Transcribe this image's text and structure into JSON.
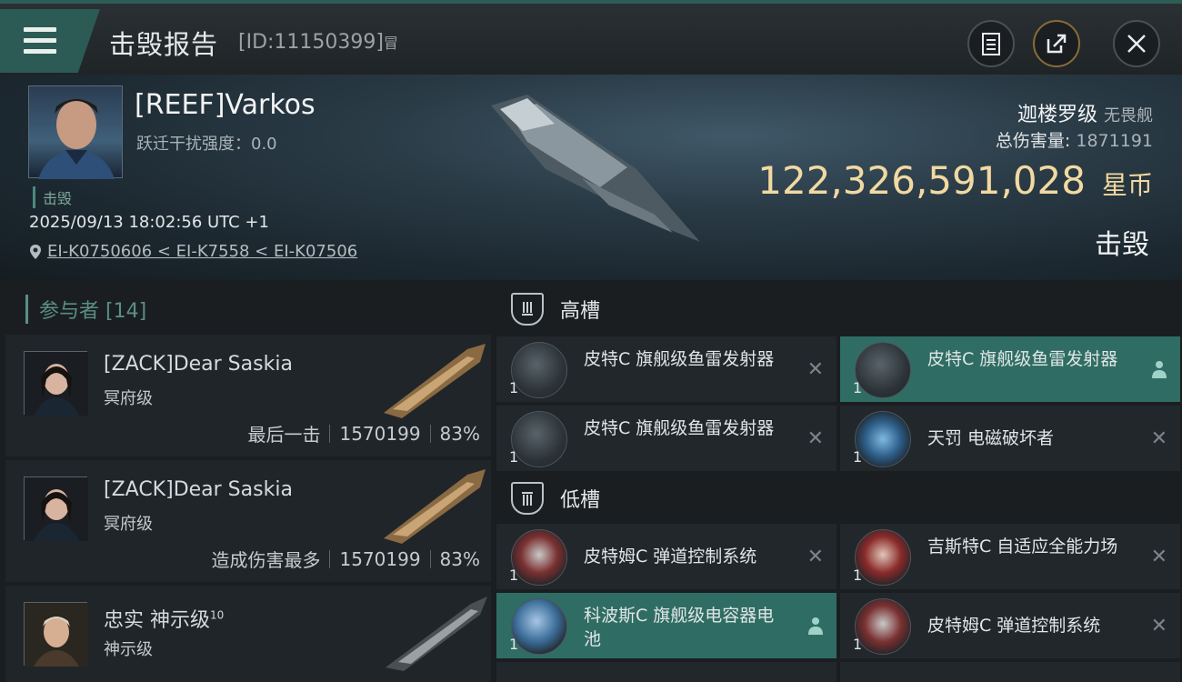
{
  "header": {
    "title": "击毁报告",
    "id_text": "[ID:11150399]",
    "copy_glyph": "冒"
  },
  "victim": {
    "pilot_name": "[REEF]Varkos",
    "warp_label": "跃迁干扰强度：",
    "warp_value": "0.0",
    "status": "击毁",
    "datetime": "2025/09/13 18:02:56 UTC +1",
    "location": "EI-K0750606 < EI-K7558 < EI-K07506",
    "ship_name": "迦楼罗级",
    "ship_class": "无畏舰",
    "total_damage_label": "总伤害量:",
    "total_damage_value": "1871191",
    "isk_value": "122,326,591,028",
    "isk_unit": "星币",
    "result": "击毁"
  },
  "participants": {
    "header": "参与者 [14]",
    "rows": [
      {
        "name": "[ZACK]Dear Saskia",
        "sup": "",
        "ship": "冥府级",
        "tag": "最后一击",
        "damage": "1570199",
        "percent": "83%"
      },
      {
        "name": "[ZACK]Dear Saskia",
        "sup": "",
        "ship": "冥府级",
        "tag": "造成伤害最多",
        "damage": "1570199",
        "percent": "83%"
      },
      {
        "name": "忠实 神示级",
        "sup": "10",
        "ship": "神示级",
        "tag": "",
        "damage": "",
        "percent": ""
      }
    ]
  },
  "fitting": {
    "high_label": "高槽",
    "low_label": "低槽",
    "high": [
      {
        "name": "皮特C 旗舰级鱼雷发射器",
        "qty": "1"
      },
      {
        "name": "皮特C 旗舰级鱼雷发射器",
        "qty": "1"
      },
      {
        "name": "皮特C 旗舰级鱼雷发射器",
        "qty": "1"
      },
      {
        "name": "天罚 电磁破坏者",
        "qty": "1"
      }
    ],
    "low": [
      {
        "name": "皮特姆C 弹道控制系统",
        "qty": "1"
      },
      {
        "name": "吉斯特C 自适应全能力场",
        "qty": "1"
      },
      {
        "name": "科波斯C 旗舰级电容器电池",
        "qty": "1"
      },
      {
        "name": "皮特姆C 弹道控制系统",
        "qty": "1"
      }
    ]
  },
  "colors": {
    "accent": "#2f6d64",
    "isk": "#f2d9a2"
  }
}
